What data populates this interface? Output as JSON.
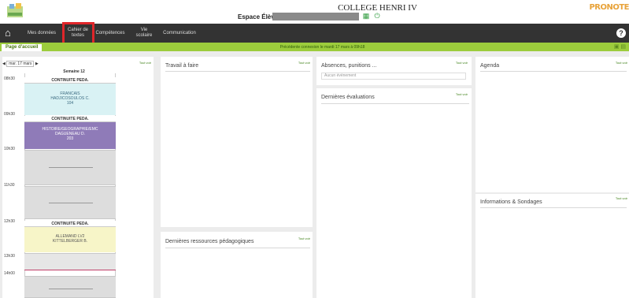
{
  "header": {
    "school_name": "COLLEGE HENRI IV",
    "space_label": "Espace Élèves -",
    "brand": "PRONOTE"
  },
  "nav": {
    "items": [
      {
        "label": "Mes données"
      },
      {
        "label": "Cahier de textes"
      },
      {
        "label": "Compétences"
      },
      {
        "label": "Vie scolaire"
      },
      {
        "label": "Communication"
      }
    ],
    "highlighted": "Cahier de textes",
    "help": "?"
  },
  "subbar": {
    "home_tab": "Page d'accueil",
    "connection_message": "Précédente connexion le mardi 17 mars à 09h18"
  },
  "schedule": {
    "date_selector": "mar. 17 mars",
    "week": "Semaine 12",
    "see_all": "Tout voir",
    "times": [
      "08h30",
      "09h30",
      "10h30",
      "11h30",
      "12h30",
      "13h30",
      "14h00"
    ],
    "courses": [
      {
        "header": "CONTINUITE PEDA.",
        "subject": "FRANCAIS",
        "teacher": "HADJICOSOULOS C.",
        "room": "104",
        "color": "#d9f2f4"
      },
      {
        "header": "CONTINUITE PEDA.",
        "subject": "HISTOIRE/GEOGRAPHIE/EMC",
        "teacher": "DAGUENEAU D.",
        "room": "203",
        "color": "#8f7bb8"
      },
      {
        "header": "CONTINUITE PEDA.",
        "subject": "ALLEMAND LV2",
        "teacher": "KITTELBERGER B.",
        "room": "",
        "color": "#f7f5c8"
      }
    ]
  },
  "panels": {
    "travail": {
      "title": "Travail à faire",
      "see_all": "Tout voir"
    },
    "absences": {
      "title": "Absences, punitions ...",
      "see_all": "Tout voir",
      "empty": "Aucun évènement"
    },
    "evaluations": {
      "title": "Dernières évaluations",
      "see_all": "Tout voir"
    },
    "agenda": {
      "title": "Agenda",
      "see_all": "Tout voir"
    },
    "ressources": {
      "title": "Dernières ressources pédagogiques",
      "see_all": "Tout voir"
    },
    "informations": {
      "title": "Informations & Sondages",
      "see_all": "Tout voir"
    }
  },
  "colors": {
    "navbar": "#333333",
    "accent_green": "#9ccc3c",
    "highlight": "#e0262a",
    "brand": "#e8a33a"
  }
}
